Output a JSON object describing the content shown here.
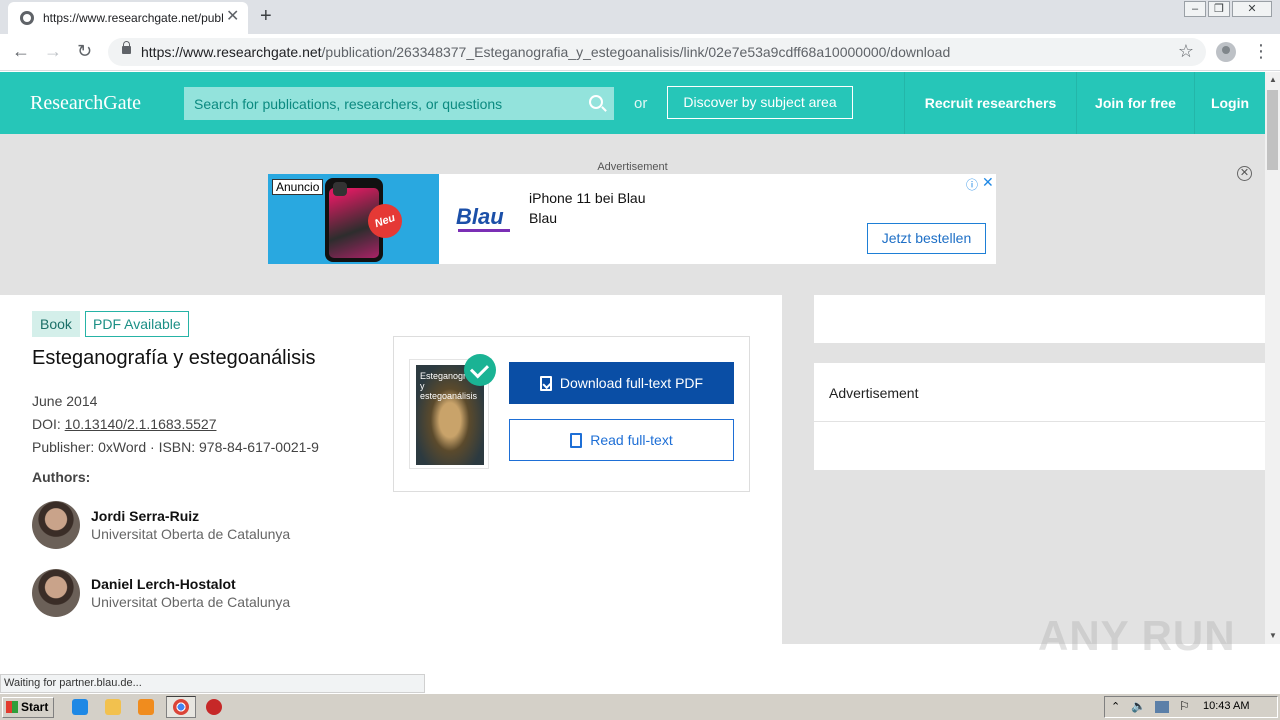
{
  "browser": {
    "tab_title": "https://www.researchgate.net/publi",
    "url_host": "https://www.researchgate.net",
    "url_path": "/publication/263348377_Esteganografia_y_estegoanalisis/link/02e7e53a9cdff68a10000000/download"
  },
  "header": {
    "logo": "ResearchGate",
    "search_placeholder": "Search for publications, researchers, or questions",
    "or_label": "or",
    "discover_label": "Discover by subject area",
    "recruit_label": "Recruit researchers",
    "join_label": "Join for free",
    "login_label": "Login"
  },
  "ad": {
    "label": "Advertisement",
    "badge": "Anuncio",
    "new_badge": "Neu",
    "brand_logo": "Blau",
    "title": "iPhone 11 bei Blau",
    "subtitle": "Blau",
    "cta": "Jetzt bestellen"
  },
  "publication": {
    "tag_book": "Book",
    "tag_pdf": "PDF Available",
    "title": "Esteganografía y estegoanálisis",
    "date": "June 2014",
    "doi_label": "DOI: ",
    "doi": "10.13140/2.1.1683.5527",
    "publisher_line": "Publisher: 0xWord · ISBN: 978-84-617-0021-9",
    "authors_label": "Authors:",
    "authors": [
      {
        "name": "Jordi Serra-Ruiz",
        "affiliation": "Universitat Oberta de Catalunya"
      },
      {
        "name": "Daniel Lerch-Hostalot",
        "affiliation": "Universitat Oberta de Catalunya"
      }
    ],
    "cover_text": "Esteganografía y estegoanálisis",
    "download_label": "Download full-text PDF",
    "read_label": "Read full-text"
  },
  "sidebar": {
    "ad_label": "Advertisement"
  },
  "status": {
    "text": "Waiting for partner.blau.de..."
  },
  "watermark": "ANY RUN",
  "taskbar": {
    "start_label": "Start",
    "clock": "10:43 AM"
  },
  "colors": {
    "brand": "#26c6b8",
    "download_button": "#0a4ea5",
    "link_blue": "#1e6fd6"
  }
}
